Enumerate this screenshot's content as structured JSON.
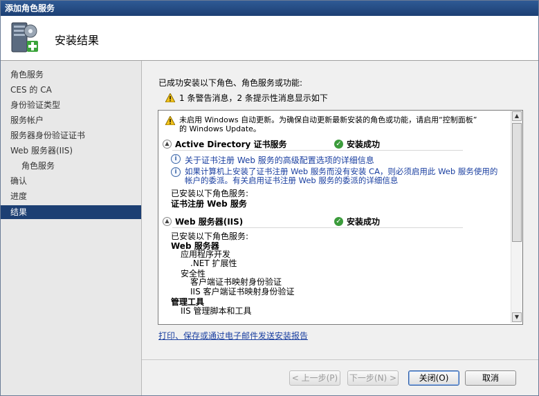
{
  "window": {
    "title": "添加角色服务"
  },
  "header": {
    "title": "安装结果",
    "icon": "server-gear-add-icon"
  },
  "sidebar": {
    "items": [
      {
        "label": "角色服务"
      },
      {
        "label": "CES 的 CA"
      },
      {
        "label": "身份验证类型"
      },
      {
        "label": "服务帐户"
      },
      {
        "label": "服务器身份验证证书"
      },
      {
        "label": "Web 服务器(IIS)"
      },
      {
        "label": "角色服务"
      },
      {
        "label": "确认"
      },
      {
        "label": "进度"
      },
      {
        "label": "结果"
      }
    ],
    "active_index": 9
  },
  "main": {
    "intro": "已成功安装以下角色、角色服务或功能:",
    "warning_summary": "1 条警告消息，2 条提示性消息显示如下",
    "results": {
      "warning": {
        "line1": "未启用 Windows 自动更新。为确保自动更新最新安装的角色或功能，请启用“控制面板”",
        "line2": "的 Windows Update。"
      },
      "section1": {
        "title": "Active Directory 证书服务",
        "status": "安装成功",
        "info1": "关于证书注册 Web 服务的高级配置选项的详细信息",
        "info2_line1": "如果计算机上安装了证书注册 Web 服务而没有安装 CA，则必须启用此 Web 服务使用的",
        "info2_line2": "帐户的委派。有关启用证书注册 Web 服务的委派的详细信息",
        "installed_label": "已安装以下角色服务:",
        "installed_item": "证书注册 Web 服务"
      },
      "section2": {
        "title": "Web 服务器(IIS)",
        "status": "安装成功",
        "installed_label": "已安装以下角色服务:",
        "tree": {
          "web_server": "Web 服务器",
          "app_dev": "应用程序开发",
          "net_ext": ".NET 扩展性",
          "security": "安全性",
          "client_cert": "客户端证书映射身份验证",
          "iis_client_cert": "IIS 客户端证书映射身份验证",
          "mgmt_tools": "管理工具",
          "iis_scripts": "IIS 管理脚本和工具"
        }
      }
    },
    "report_link": "打印、保存或通过电子邮件发送安装报告"
  },
  "buttons": {
    "prev": "< 上一步(P)",
    "next": "下一步(N) >",
    "close": "关闭(O)",
    "cancel": "取消"
  },
  "colors": {
    "title_bar": "#1c3f73",
    "active_nav": "#1c3f73",
    "link": "#1a3fa0",
    "success": "#3b9b3b",
    "warning": "#f2c21b"
  }
}
